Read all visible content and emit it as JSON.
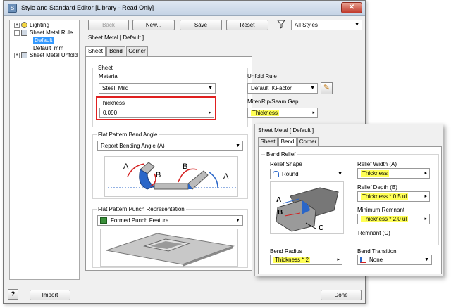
{
  "window": {
    "title": "Style and Standard Editor [Library - Read Only]",
    "close": "✕"
  },
  "tree": {
    "items": [
      {
        "label": "Lighting",
        "expander": "+"
      },
      {
        "label": "Sheet Metal Rule",
        "expander": "−"
      },
      {
        "label": "Default"
      },
      {
        "label": "Default_mm"
      },
      {
        "label": "Sheet Metal Unfold",
        "expander": "+"
      }
    ]
  },
  "toolbar": {
    "back": "Back",
    "new": "New...",
    "save": "Save",
    "reset": "Reset",
    "filter_icon": "filter-icon",
    "styles_filter": "All Styles"
  },
  "heading": "Sheet Metal [ Default ]",
  "tabs": [
    "Sheet",
    "Bend",
    "Corner"
  ],
  "sheet": {
    "group_label": "Sheet",
    "material_label": "Material",
    "material_value": "Steel, Mild",
    "thickness_label": "Thickness",
    "thickness_value": "0.090",
    "unfold_rule_label": "Unfold Rule",
    "unfold_rule_value": "Default_KFactor",
    "gap_label": "Miter/Rip/Seam Gap",
    "gap_value": "Thickness"
  },
  "bend_angle": {
    "label": "Flat Pattern Bend Angle",
    "value": "Report Bending Angle (A)",
    "diagram_labels": [
      "A",
      "B",
      "B",
      "A"
    ]
  },
  "punch": {
    "label": "Flat Pattern Punch Representation",
    "value": "Formed Punch Feature"
  },
  "inset": {
    "heading": "Sheet Metal [ Default ]",
    "tabs": [
      "Sheet",
      "Bend",
      "Corner"
    ],
    "group_label": "Bend Relief",
    "relief_shape_label": "Relief Shape",
    "relief_shape_value": "Round",
    "relief_width_label": "Relief Width (A)",
    "relief_width_value": "Thickness",
    "relief_depth_label": "Relief Depth (B)",
    "relief_depth_value": "Thickness * 0.5 ul",
    "min_remnant_label": "Minimum Remnant",
    "min_remnant_value": "Thickness * 2.0 ul",
    "remnant_c_label": "Remnant (C)",
    "bend_radius_label": "Bend Radius",
    "bend_radius_value": "Thickness * 2",
    "bend_transition_label": "Bend Transition",
    "bend_transition_value": "None",
    "diagram_labels": [
      "A",
      "B",
      "C"
    ]
  },
  "footer": {
    "help": "?",
    "import": "Import",
    "done": "Done"
  },
  "colors": {
    "highlight": "#ffff55",
    "callout": "#e02020",
    "accent_blue": "#2a66c8",
    "arc_red": "#d42020"
  }
}
